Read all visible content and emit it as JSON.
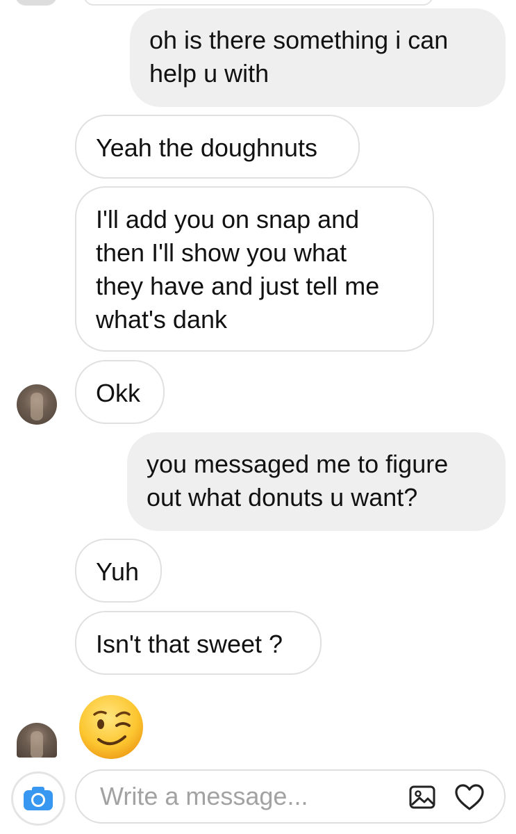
{
  "messages": [
    {
      "text": "oh is there something i can help u with",
      "line1": "oh is there something i can",
      "line2": "help u with",
      "side": "sent"
    },
    {
      "text": "Yeah the doughnuts",
      "side": "received"
    },
    {
      "line1": "I'll add you on snap and",
      "line2": "then I'll show you what",
      "line3": "they have and just tell me",
      "line4": "what's dank",
      "side": "received"
    },
    {
      "text": "Okk",
      "side": "received"
    },
    {
      "line1": "you messaged me to figure",
      "line2": "out what donuts u want?",
      "side": "sent"
    },
    {
      "text": "Yuh",
      "side": "received"
    },
    {
      "text": "Isn't that sweet ?",
      "side": "received"
    },
    {
      "emoji": "😉",
      "side": "received"
    }
  ],
  "composer": {
    "placeholder": "Write a message...",
    "value": ""
  },
  "icons": {
    "camera": "camera-icon",
    "gallery": "image-icon",
    "like": "heart-icon"
  },
  "colors": {
    "camera_accent": "#3897f0",
    "sent_bubble": "#efefef",
    "received_border": "#e0e0e0",
    "placeholder": "#a2a2a2"
  }
}
